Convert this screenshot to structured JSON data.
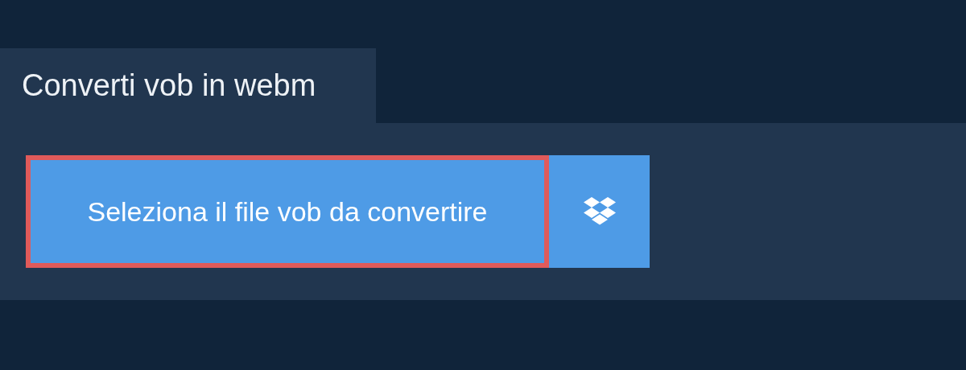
{
  "tab": {
    "title": "Converti vob in webm"
  },
  "upload": {
    "label": "Seleziona il file vob da convertire",
    "highlighted": true
  }
}
